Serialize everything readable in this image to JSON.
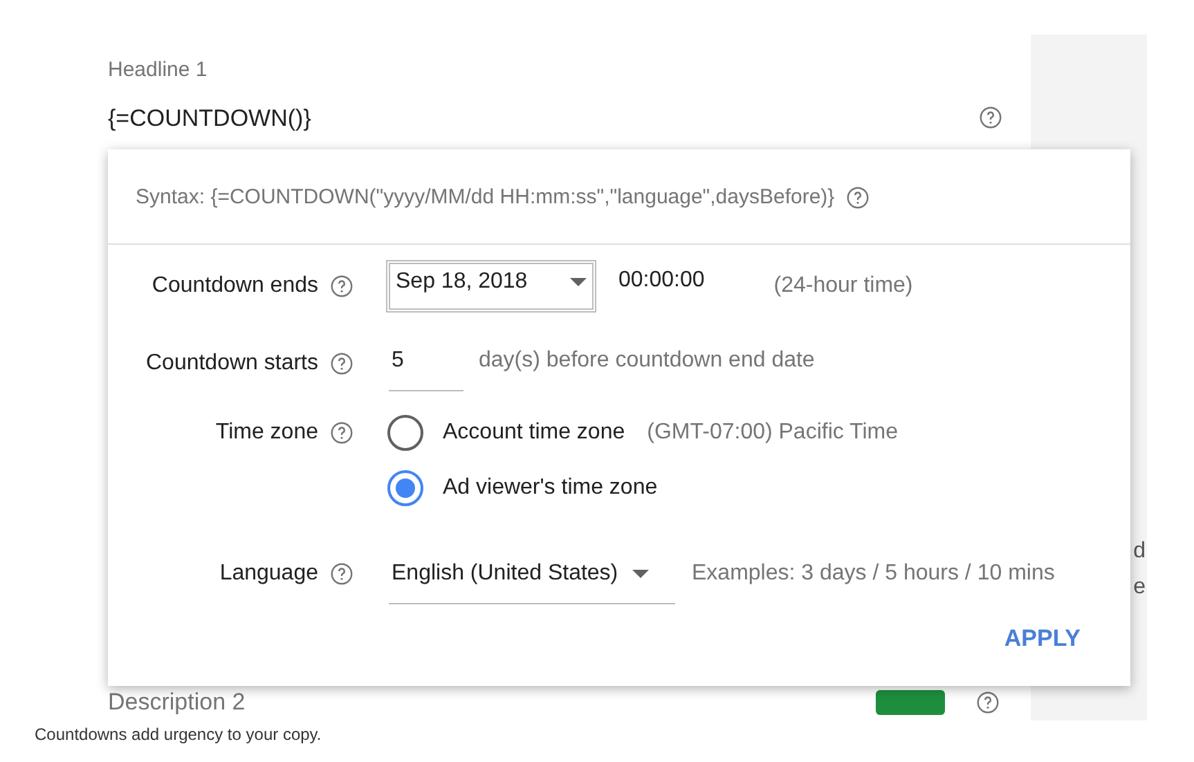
{
  "headline": {
    "label": "Headline 1",
    "value": "{=COUNTDOWN()}"
  },
  "popup": {
    "syntax": "Syntax: {=COUNTDOWN(\"yyyy/MM/dd HH:mm:ss\",\"language\",daysBefore)}",
    "countdown_ends": {
      "label": "Countdown ends",
      "date": "Sep 18, 2018",
      "time": "00:00:00",
      "hint": "(24-hour time)"
    },
    "countdown_starts": {
      "label": "Countdown starts",
      "value": "5",
      "suffix": "day(s) before countdown end date"
    },
    "time_zone": {
      "label": "Time zone",
      "options": [
        {
          "label": "Account time zone",
          "detail": "(GMT-07:00) Pacific Time",
          "selected": false
        },
        {
          "label": "Ad viewer's time zone",
          "selected": true
        }
      ]
    },
    "language": {
      "label": "Language",
      "value": "English (United States)",
      "examples": "Examples: 3 days / 5 hours / 10 mins"
    },
    "apply": "APPLY"
  },
  "description": {
    "label": "Description 2"
  },
  "side_panel": {
    "texts": [
      "d",
      "e"
    ]
  },
  "caption": "Countdowns add urgency to your copy."
}
